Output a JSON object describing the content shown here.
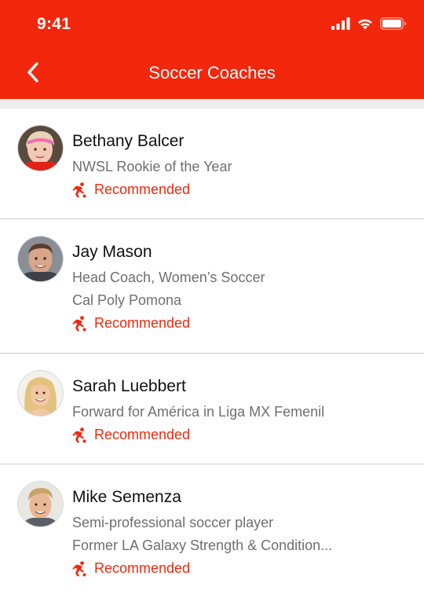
{
  "status_bar": {
    "time": "9:41",
    "icons": [
      "signal-icon",
      "wifi-icon",
      "battery-icon"
    ]
  },
  "nav": {
    "back_icon": "chevron-left-icon",
    "title": "Soccer Coaches"
  },
  "colors": {
    "brand": "#f2270c",
    "name_text": "#111111",
    "secondary_text": "#6f6f6f",
    "divider": "#c8c8c8",
    "band": "#ededed"
  },
  "coaches": [
    {
      "name": "Bethany Balcer",
      "lines": [
        "NWSL Rookie of the Year"
      ],
      "badge": "Recommended"
    },
    {
      "name": "Jay Mason",
      "lines": [
        "Head Coach, Women’s Soccer",
        "Cal Poly Pomona"
      ],
      "badge": "Recommended"
    },
    {
      "name": "Sarah Luebbert",
      "lines": [
        "Forward for América in Liga MX Femenil"
      ],
      "badge": "Recommended"
    },
    {
      "name": "Mike Semenza",
      "lines": [
        "Semi-professional soccer player",
        "Former LA Galaxy Strength & Condition..."
      ],
      "badge": "Recommended"
    }
  ]
}
